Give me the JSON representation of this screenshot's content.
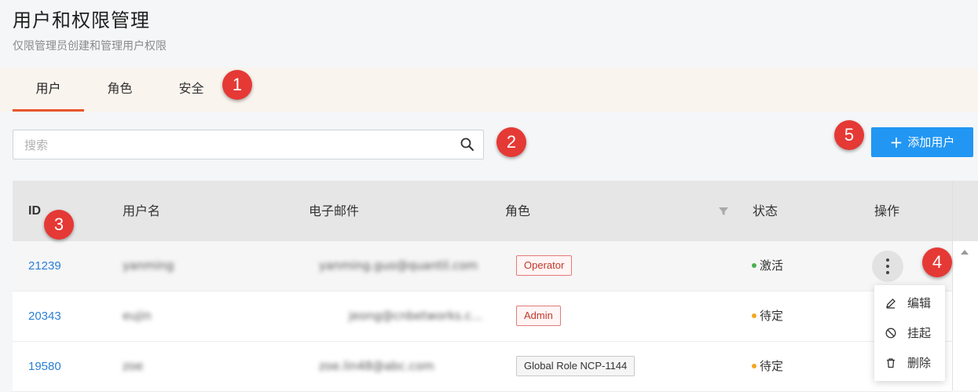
{
  "header": {
    "title": "用户和权限管理",
    "subtitle": "仅限管理员创建和管理用户权限"
  },
  "tabs": [
    {
      "label": "用户",
      "active": true
    },
    {
      "label": "角色",
      "active": false
    },
    {
      "label": "安全",
      "active": false
    }
  ],
  "search": {
    "placeholder": "搜索",
    "value": "",
    "icon": "search-icon"
  },
  "add_button": {
    "label": "添加用户",
    "icon": "plus-icon"
  },
  "badges": [
    "1",
    "2",
    "3",
    "4",
    "5"
  ],
  "table": {
    "columns": [
      "ID",
      "用户名",
      "电子邮件",
      "角色",
      "状态",
      "操作"
    ],
    "rows": [
      {
        "id": "21239",
        "username": "yanming",
        "email": "yanming.guo@quantil.com",
        "role": "Operator",
        "role_style": "red",
        "status": "激活",
        "status_color": "#4caf50"
      },
      {
        "id": "20343",
        "username": "eujin",
        "email": "jeong@cnbetworks.c...",
        "role": "Admin",
        "role_style": "red",
        "status": "待定",
        "status_color": "#f5a623"
      },
      {
        "id": "19580",
        "username": "zoe",
        "email": "zoe.lin48@abc.com",
        "role": "Global Role NCP-1144",
        "role_style": "grey",
        "status": "待定",
        "status_color": "#f5a623"
      }
    ]
  },
  "action_menu": {
    "items": [
      {
        "label": "编辑",
        "icon": "edit-icon"
      },
      {
        "label": "挂起",
        "icon": "suspend-icon"
      },
      {
        "label": "删除",
        "icon": "trash-icon"
      }
    ]
  },
  "colors": {
    "accent": "#2196f3",
    "tab_underline": "#e8562a",
    "badge": "#e53935",
    "link": "#2a7fd4"
  }
}
